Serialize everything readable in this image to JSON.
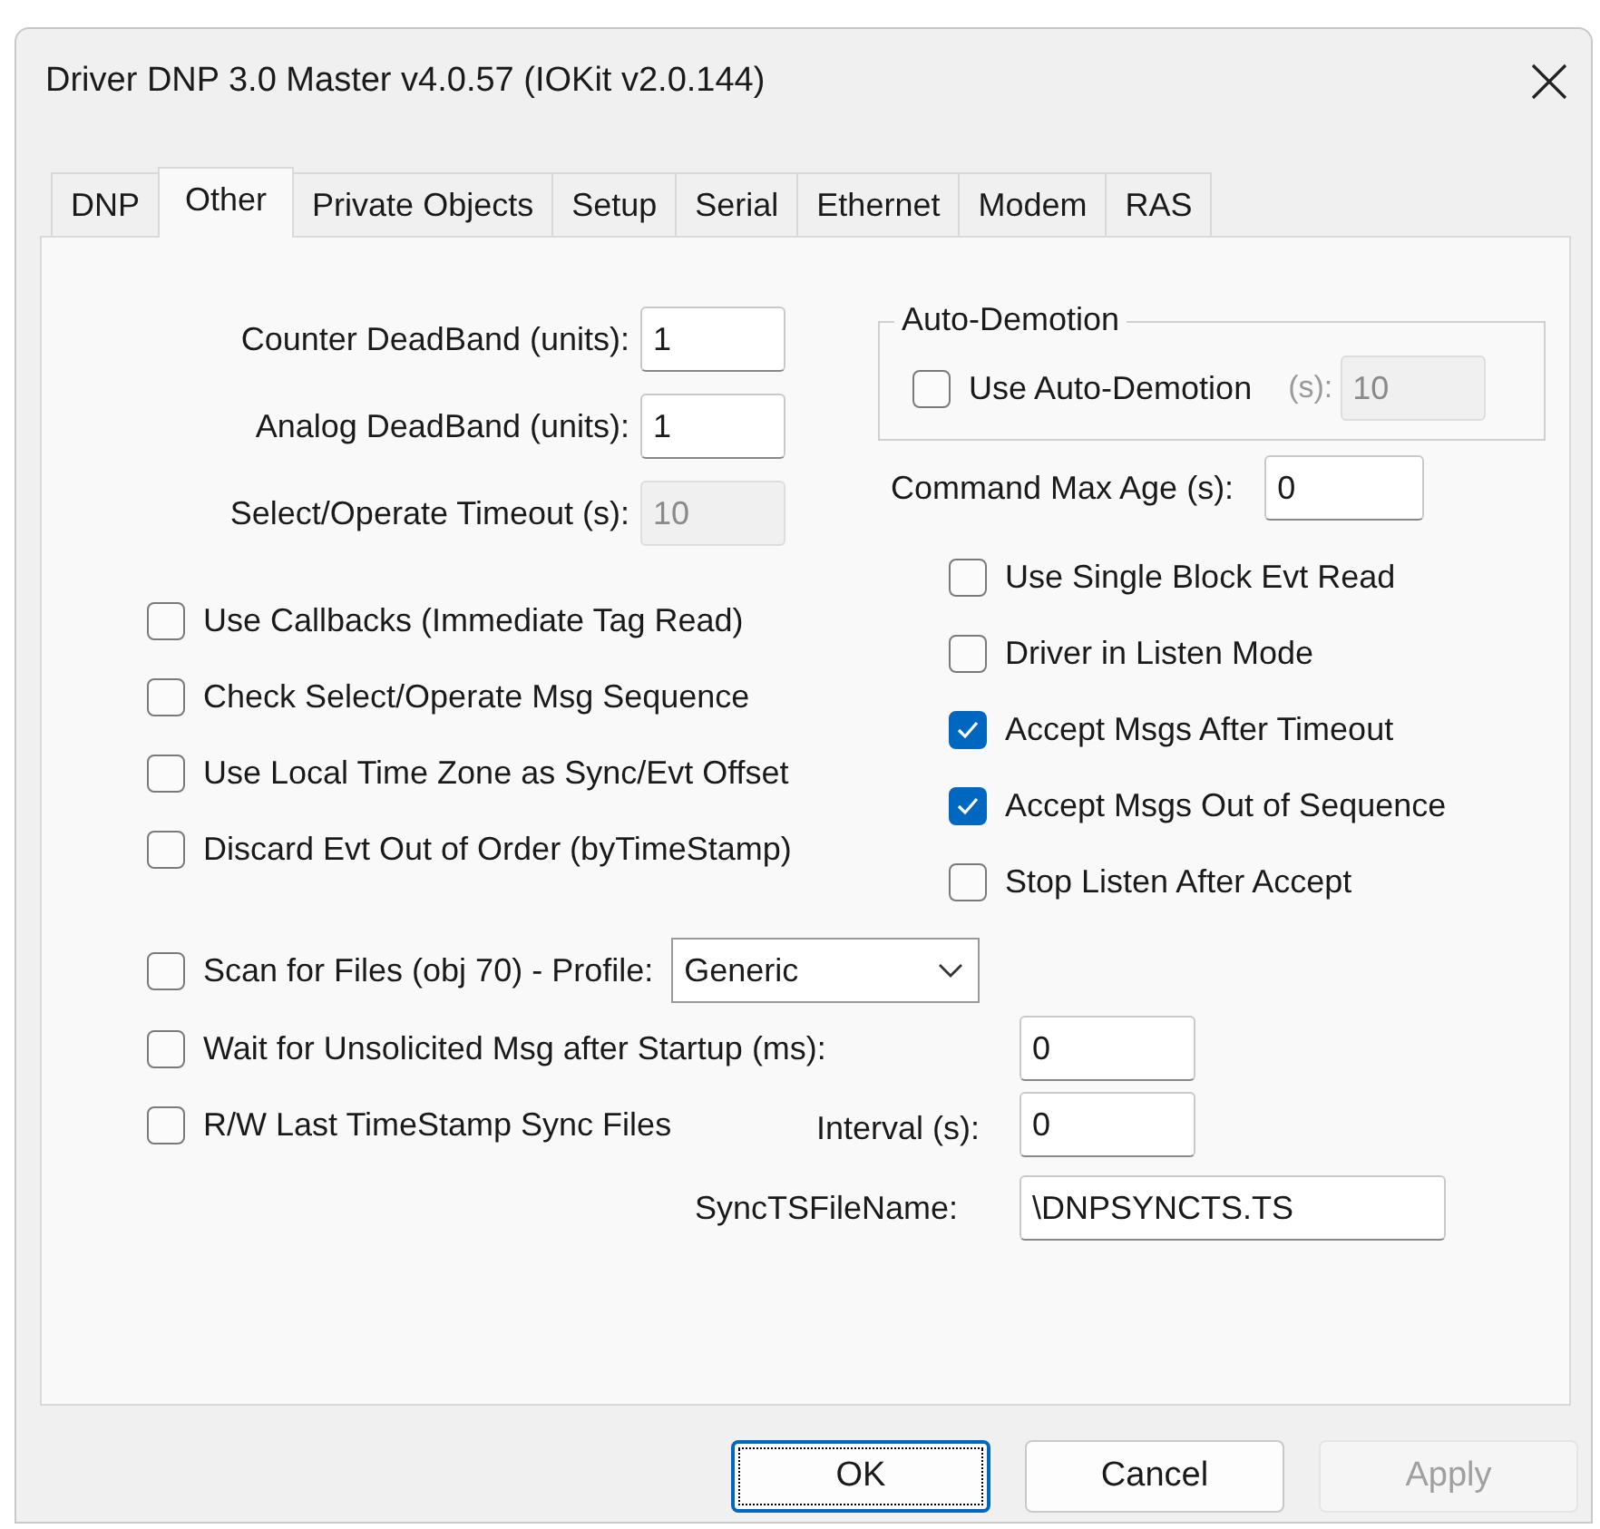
{
  "window": {
    "title": "Driver DNP 3.0 Master v4.0.57 (IOKit v2.0.144)"
  },
  "tabs": [
    {
      "label": "DNP",
      "selected": false
    },
    {
      "label": "Other",
      "selected": true
    },
    {
      "label": "Private Objects",
      "selected": false
    },
    {
      "label": "Setup",
      "selected": false
    },
    {
      "label": "Serial",
      "selected": false
    },
    {
      "label": "Ethernet",
      "selected": false
    },
    {
      "label": "Modem",
      "selected": false
    },
    {
      "label": "RAS",
      "selected": false
    }
  ],
  "fields": [
    {
      "label": "Counter DeadBand (units):",
      "value": "1",
      "disabled": false
    },
    {
      "label": "Analog DeadBand (units):",
      "value": "1",
      "disabled": false
    },
    {
      "label": "Select/Operate Timeout (s):",
      "value": "10",
      "disabled": true
    }
  ],
  "auto_demotion": {
    "title": "Auto-Demotion",
    "checkbox": {
      "label": "Use Auto-Demotion",
      "checked": false
    },
    "unit_label": "(s):",
    "value": "10",
    "disabled": true
  },
  "command_max_age": {
    "label": "Command Max Age (s):",
    "value": "0"
  },
  "options_left": [
    {
      "label": "Use Callbacks (Immediate Tag Read)",
      "checked": false
    },
    {
      "label": "Check Select/Operate Msg Sequence",
      "checked": false
    },
    {
      "label": "Use Local Time Zone as Sync/Evt Offset",
      "checked": false
    },
    {
      "label": "Discard Evt Out of Order (byTimeStamp)",
      "checked": false
    }
  ],
  "options_right": [
    {
      "label": "Use Single Block Evt Read",
      "checked": false
    },
    {
      "label": "Driver in Listen Mode",
      "checked": false
    },
    {
      "label": "Accept Msgs After Timeout",
      "checked": true
    },
    {
      "label": "Accept Msgs Out of Sequence",
      "checked": true
    },
    {
      "label": "Stop Listen After Accept",
      "checked": false
    }
  ],
  "scan_files": {
    "label": "Scan for Files (obj 70) - Profile:",
    "checked": false,
    "profile": "Generic"
  },
  "wait_unsolicited": {
    "label": "Wait for Unsolicited Msg after Startup (ms):",
    "checked": false,
    "value": "0"
  },
  "rw_sync": {
    "label": "R/W Last TimeStamp Sync Files",
    "checked": false,
    "interval_label": "Interval (s):",
    "value": "0"
  },
  "sync_file": {
    "label": "SyncTSFileName:",
    "value": "\\DNPSYNCTS.TS"
  },
  "buttons": [
    {
      "label": "OK",
      "default": true,
      "disabled": false
    },
    {
      "label": "Cancel",
      "default": false,
      "disabled": false
    },
    {
      "label": "Apply",
      "default": false,
      "disabled": true
    }
  ]
}
